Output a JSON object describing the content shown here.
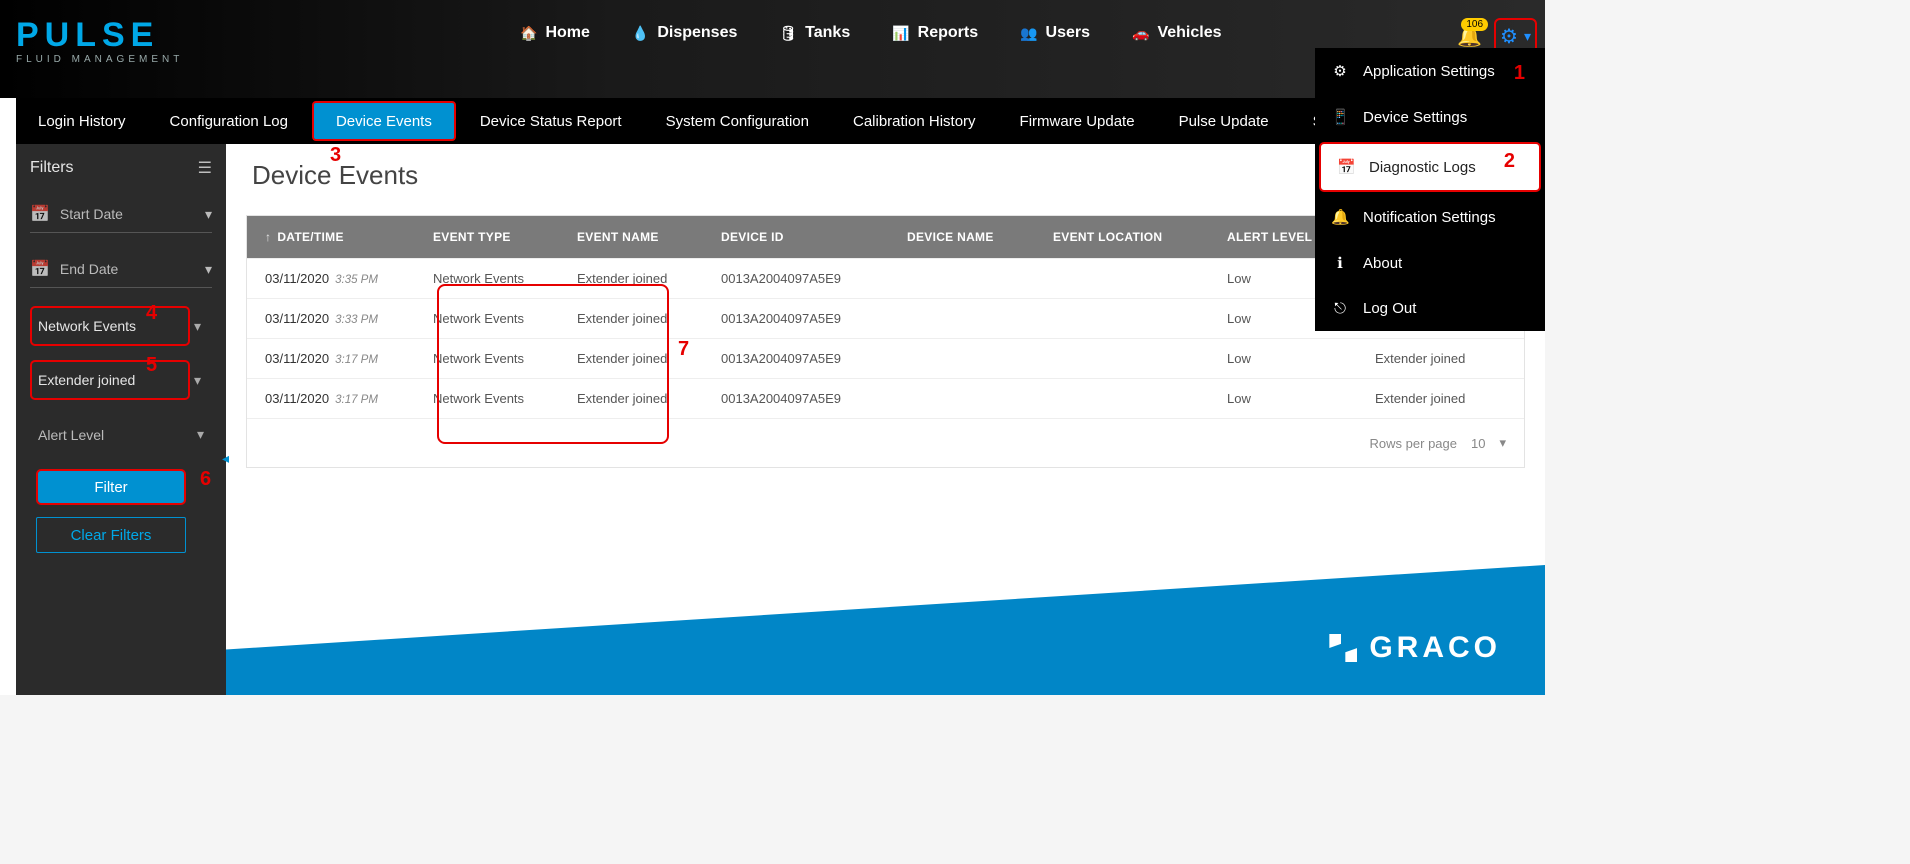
{
  "logo": {
    "title": "PULSE",
    "subtitle": "FLUID MANAGEMENT"
  },
  "nav": {
    "home": "Home",
    "dispenses": "Dispenses",
    "tanks": "Tanks",
    "reports": "Reports",
    "users": "Users",
    "vehicles": "Vehicles"
  },
  "notifications": {
    "count": "106"
  },
  "tabs": {
    "login_history": "Login History",
    "configuration_log": "Configuration Log",
    "device_events": "Device Events",
    "device_status_report": "Device Status Report",
    "system_configuration": "System Configuration",
    "calibration_history": "Calibration History",
    "firmware_update": "Firmware Update",
    "pulse_update": "Pulse Update",
    "system_logs": "System Logs"
  },
  "filters_panel": {
    "title": "Filters",
    "start_date": "Start Date",
    "end_date": "End Date",
    "event_type_value": "Network Events",
    "event_name_value": "Extender joined",
    "alert_level": "Alert Level",
    "filter_btn": "Filter",
    "clear_btn": "Clear Filters"
  },
  "page": {
    "title": "Device Events"
  },
  "table": {
    "headers": {
      "datetime": "DATE/TIME",
      "event_type": "EVENT TYPE",
      "event_name": "EVENT NAME",
      "device_id": "DEVICE ID",
      "device_name": "DEVICE NAME",
      "event_location": "EVENT LOCATION",
      "alert_level": "ALERT LEVEL"
    },
    "rows": [
      {
        "date": "03/11/2020",
        "time": "3:35 PM",
        "type": "Network Events",
        "name": "Extender joined",
        "devid": "0013A2004097A5E9",
        "devname": "",
        "loc": "",
        "alert": "Low",
        "extra": ""
      },
      {
        "date": "03/11/2020",
        "time": "3:33 PM",
        "type": "Network Events",
        "name": "Extender joined",
        "devid": "0013A2004097A5E9",
        "devname": "",
        "loc": "",
        "alert": "Low",
        "extra": "Extender joined"
      },
      {
        "date": "03/11/2020",
        "time": "3:17 PM",
        "type": "Network Events",
        "name": "Extender joined",
        "devid": "0013A2004097A5E9",
        "devname": "",
        "loc": "",
        "alert": "Low",
        "extra": "Extender joined"
      },
      {
        "date": "03/11/2020",
        "time": "3:17 PM",
        "type": "Network Events",
        "name": "Extender joined",
        "devid": "0013A2004097A5E9",
        "devname": "",
        "loc": "",
        "alert": "Low",
        "extra": "Extender joined"
      }
    ],
    "rows_per_page_label": "Rows per page",
    "rows_per_page_value": "10"
  },
  "settings_menu": {
    "application_settings": "Application Settings",
    "device_settings": "Device Settings",
    "diagnostic_logs": "Diagnostic Logs",
    "notification_settings": "Notification Settings",
    "about": "About",
    "log_out": "Log Out"
  },
  "footer": {
    "brand": "GRACO"
  },
  "annotations": {
    "a1": "1",
    "a2": "2",
    "a3": "3",
    "a4": "4",
    "a5": "5",
    "a6": "6",
    "a7": "7"
  }
}
